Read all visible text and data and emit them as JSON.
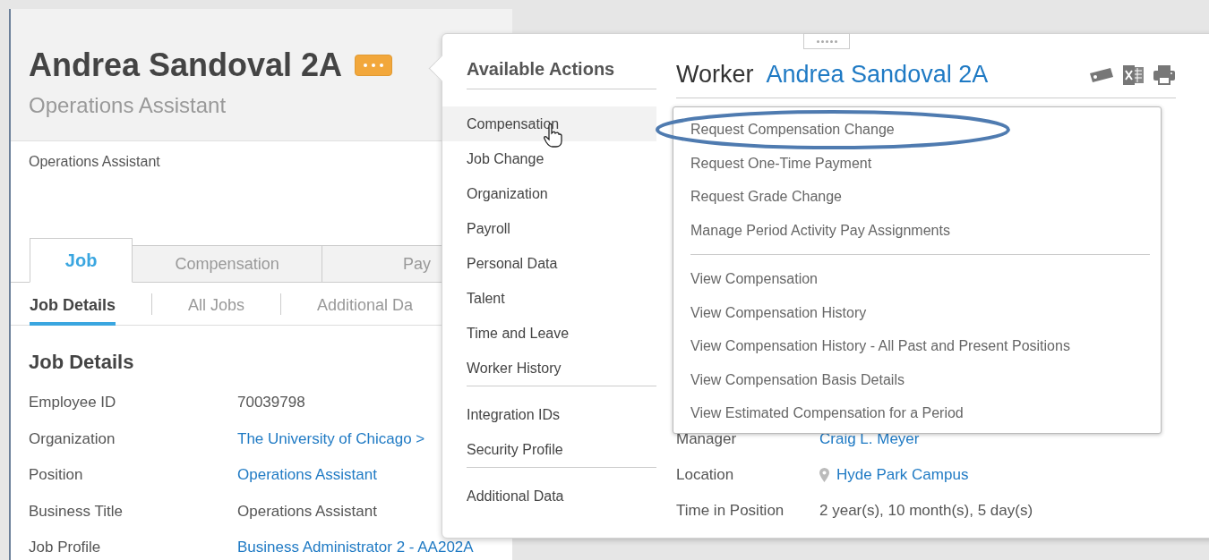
{
  "header": {
    "name": "Andrea Sandoval 2A",
    "subtitle": "Operations Assistant",
    "note": "Operations Assistant"
  },
  "tabs": [
    {
      "label": "Job",
      "selected": true
    },
    {
      "label": "Compensation",
      "selected": false
    },
    {
      "label": "Pay",
      "selected": false
    }
  ],
  "subtabs": [
    {
      "label": "Job Details",
      "selected": true
    },
    {
      "label": "All Jobs",
      "selected": false
    },
    {
      "label": "Additional Da",
      "selected": false
    }
  ],
  "section_title": "Job Details",
  "fields": [
    {
      "label": "Employee ID",
      "value": "70039798",
      "link": false
    },
    {
      "label": "Organization",
      "value": "The University of Chicago >",
      "link": true
    },
    {
      "label": "Position",
      "value": "Operations Assistant",
      "link": true
    },
    {
      "label": "Business Title",
      "value": "Operations Assistant",
      "link": false
    },
    {
      "label": "Job Profile",
      "value": "Business Administrator 2 - AA202A",
      "link": true
    }
  ],
  "popup": {
    "actions_title": "Available Actions",
    "action_groups": [
      [
        {
          "label": "Compensation",
          "selected": true
        },
        {
          "label": "Job Change",
          "selected": false
        },
        {
          "label": "Organization",
          "selected": false
        },
        {
          "label": "Payroll",
          "selected": false
        },
        {
          "label": "Personal Data",
          "selected": false
        },
        {
          "label": "Talent",
          "selected": false
        },
        {
          "label": "Time and Leave",
          "selected": false
        },
        {
          "label": "Worker History",
          "selected": false
        }
      ],
      [
        {
          "label": "Integration IDs",
          "selected": false
        },
        {
          "label": "Security Profile",
          "selected": false
        }
      ],
      [
        {
          "label": "Additional Data",
          "selected": false
        }
      ]
    ],
    "worker_label": "Worker",
    "worker_name": "Andrea Sandoval 2A",
    "submenu_groups": [
      [
        "Request Compensation Change",
        "Request One-Time Payment",
        "Request Grade Change",
        "Manage Period Activity Pay Assignments"
      ],
      [
        "View Compensation",
        "View Compensation History",
        "View Compensation History - All Past and Present Positions",
        "View Compensation Basis Details",
        "View Estimated Compensation for a Period"
      ]
    ],
    "fields": [
      {
        "label": "Manager",
        "value": "Craig L. Meyer",
        "kind": "link"
      },
      {
        "label": "Location",
        "value": "Hyde Park Campus",
        "kind": "location"
      },
      {
        "label": "Time in Position",
        "value": "2 year(s), 10 month(s), 5 day(s)",
        "kind": "text"
      }
    ]
  }
}
